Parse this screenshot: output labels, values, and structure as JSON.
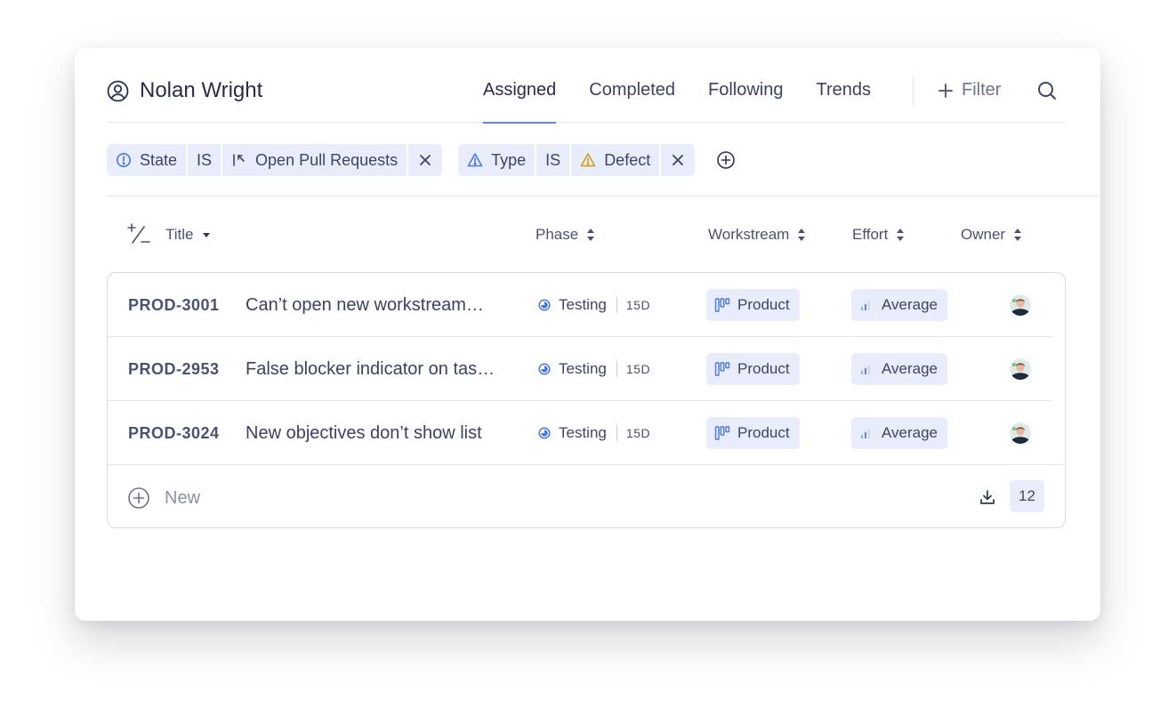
{
  "header": {
    "user_name": "Nolan Wright",
    "tabs": [
      {
        "label": "Assigned",
        "active": true
      },
      {
        "label": "Completed",
        "active": false
      },
      {
        "label": "Following",
        "active": false
      },
      {
        "label": "Trends",
        "active": false
      }
    ],
    "filter_label": "Filter"
  },
  "filters": [
    {
      "field": "State",
      "operator": "IS",
      "value": "Open Pull Requests",
      "field_icon": "info-circle-icon",
      "value_icon": "pull-request-icon"
    },
    {
      "field": "Type",
      "operator": "IS",
      "value": "Defect",
      "field_icon": "warning-triangle-icon",
      "value_icon": "warning-triangle-icon"
    }
  ],
  "table": {
    "columns": {
      "title": "Title",
      "phase": "Phase",
      "workstream": "Workstream",
      "effort": "Effort",
      "owner": "Owner"
    },
    "rows": [
      {
        "id": "PROD-3001",
        "title": "Can’t open new workstream…",
        "phase": "Testing",
        "days": "15D",
        "workstream": "Product",
        "effort": "Average"
      },
      {
        "id": "PROD-2953",
        "title": "False blocker indicator on tas…",
        "phase": "Testing",
        "days": "15D",
        "workstream": "Product",
        "effort": "Average"
      },
      {
        "id": "PROD-3024",
        "title": "New objectives don’t show list",
        "phase": "Testing",
        "days": "15D",
        "workstream": "Product",
        "effort": "Average"
      }
    ],
    "new_label": "New",
    "count": "12"
  },
  "colors": {
    "accent": "#5d86e8",
    "chip_bg": "#e9edfb",
    "warning": "#d49a1c",
    "text": "#2d3555"
  }
}
